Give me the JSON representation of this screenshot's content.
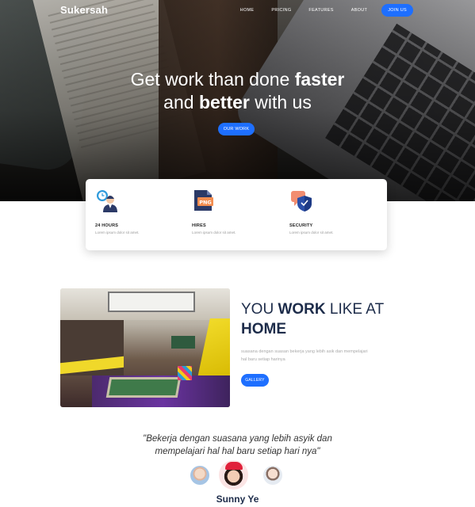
{
  "header": {
    "logo": "Sukersah",
    "nav": [
      "HOME",
      "PRICING",
      "FEATURES",
      "ABOUT"
    ],
    "cta": "JOIN US"
  },
  "hero": {
    "title_line1_pre": "Get work than done ",
    "title_line1_bold": "faster",
    "title_line2_pre": "and ",
    "title_line2_bold": "better",
    "title_line2_post": " with us",
    "button": "OUR WORK"
  },
  "features": [
    {
      "icon": "support-agent-icon",
      "title": "24 HOURS",
      "desc": "Lorem ipsum dolor sit amet."
    },
    {
      "icon": "png-file-icon",
      "title": "HIRES",
      "desc": "Lorem ipsum dolor sit amet.",
      "badge": "PNG"
    },
    {
      "icon": "security-shield-icon",
      "title": "SECURITY",
      "desc": "Lorem ipsum dolor sit amet."
    }
  ],
  "work": {
    "title_pre": "YOU ",
    "title_bold1": "WORK",
    "title_mid": " LIKE AT",
    "title_bold2": "HOME",
    "desc": "suasana dengan suasan bekerja yang lebih asik dan mempelajari hal baru setiap harinya",
    "button": "GALLERY"
  },
  "testimonial": {
    "quote_line1": "\"Bekerja dengan suasana yang lebih asyik dan",
    "quote_line2": "mempelajari hal hal baru setiap hari nya\"",
    "name": "Sunny Ye"
  },
  "colors": {
    "accent": "#1e6fff",
    "heading": "#1d2c4a"
  }
}
